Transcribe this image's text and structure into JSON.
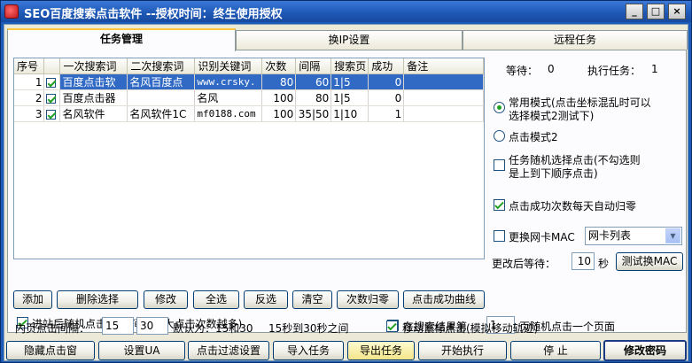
{
  "window": {
    "title": "SEO百度搜索点击软件 --授权时间：终生使用授权",
    "min_label": "_",
    "max_label": "□",
    "close_label": "×"
  },
  "tabs": [
    {
      "label": "任务管理",
      "active": true
    },
    {
      "label": "换IP设置",
      "active": false
    },
    {
      "label": "远程任务",
      "active": false
    }
  ],
  "task_table": {
    "columns": [
      "序号",
      "",
      "一次搜索词",
      "二次搜索词",
      "识别关键词",
      "次数",
      "间隔",
      "搜索页",
      "成功",
      "备注"
    ],
    "rows": [
      {
        "no": "1",
        "checked": true,
        "kw1": "百度点击软",
        "kw2": "名风百度点",
        "match": "www.crsky.",
        "times": "80",
        "interval": "60",
        "page": "1|5",
        "success": "0",
        "note": "",
        "selected": true
      },
      {
        "no": "2",
        "checked": true,
        "kw1": "百度点击器",
        "kw2": "",
        "match": "名风",
        "times": "100",
        "interval": "80",
        "page": "1|5",
        "success": "0",
        "note": "",
        "selected": false
      },
      {
        "no": "3",
        "checked": true,
        "kw1": "名风软件",
        "kw2": "名风软件1C",
        "match": "mf0188.com",
        "times": "100",
        "interval": "35|50",
        "page": "1|10",
        "success": "1",
        "note": "",
        "selected": false
      }
    ]
  },
  "table_buttons": {
    "add": "添加",
    "delete_selected": "删除选择",
    "edit": "修改",
    "select_all": "全选",
    "invert": "反选",
    "clear": "清空",
    "reset_count": "次数归零",
    "success_curve": "点击成功曲线"
  },
  "status": {
    "waiting_label": "等待：",
    "waiting_value": "0",
    "running_label": "执行任务：",
    "running_value": "1"
  },
  "options": {
    "mode_normal": "常用模式(点击坐标混乱时可以选择模式2测试下)",
    "mode_normal_line1": "常用模式(点击坐标混乱时可以",
    "mode_normal_line2": "选择模式2测试下)",
    "mode_2": "点击模式2",
    "random_line1": "任务随机选择点击(不勾选则",
    "random_line2": "是上到下顺序点击)",
    "daily_reset": "点击成功次数每天自动归零",
    "change_mac": "更换网卡MAC",
    "nic_list": "网卡列表",
    "wait_after_change": "更改后等待：",
    "wait_seconds": "10",
    "seconds_unit": "秒",
    "test_mac": "测试换MAC"
  },
  "lower": {
    "random_click_after_enter": "进站后随机点击(任务间隔越大点击次数越多)",
    "inner_interval_label": "内页点击间隔：",
    "inner_min": "15",
    "inner_max": "30",
    "default_hint": "默认为：15和30",
    "range_hint": "15秒到30秒之间",
    "search_result_label": "在搜索结果第",
    "search_result_page": "1",
    "search_result_tail": "页随机点击一个页面",
    "move_mouse": "移动鼠标点击(模拟移动轨迹)"
  },
  "bottom_buttons": {
    "hide_window": "隐藏点击窗",
    "set_ua": "设置UA",
    "filter": "点击过滤设置",
    "import": "导入任务",
    "export": "导出任务",
    "start": "开始执行",
    "stop": "停  止",
    "change_password": "修改密码"
  }
}
